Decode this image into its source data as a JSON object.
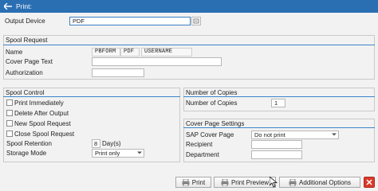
{
  "window": {
    "title": "Print:"
  },
  "output": {
    "label": "Output Device",
    "value": "PDF"
  },
  "spool_request": {
    "title": "Spool Request",
    "name_label": "Name",
    "name_parts": [
      "PBFORM",
      "PDF",
      "USERNAME"
    ],
    "cover_text_label": "Cover Page Text",
    "cover_text_value": "",
    "authorization_label": "Authorization",
    "authorization_value": ""
  },
  "spool_control": {
    "title": "Spool Control",
    "checkboxes": [
      {
        "label": "Print Immediately",
        "checked": false
      },
      {
        "label": "Delete After Output",
        "checked": false
      },
      {
        "label": "New Spool Request",
        "checked": false
      },
      {
        "label": "Close Spool Request",
        "checked": false
      }
    ],
    "retention_label": "Spool Retention",
    "retention_value": "8",
    "retention_unit": "Day(s)",
    "storage_label": "Storage Mode",
    "storage_value": "Print only"
  },
  "copies": {
    "title": "Number of Copies",
    "label": "Number of Copies",
    "value": "1"
  },
  "cover_settings": {
    "title": "Cover Page Settings",
    "sap_cover_label": "SAP Cover Page",
    "sap_cover_value": "Do not print",
    "recipient_label": "Recipient",
    "recipient_value": "",
    "department_label": "Department",
    "department_value": ""
  },
  "footer": {
    "print_label": "Print",
    "preview_label": "Print Preview",
    "options_label": "Additional Options"
  },
  "colors": {
    "titlebar": "#2b6fb3",
    "accent_line": "#3b84c9",
    "close": "#d83a2b"
  }
}
